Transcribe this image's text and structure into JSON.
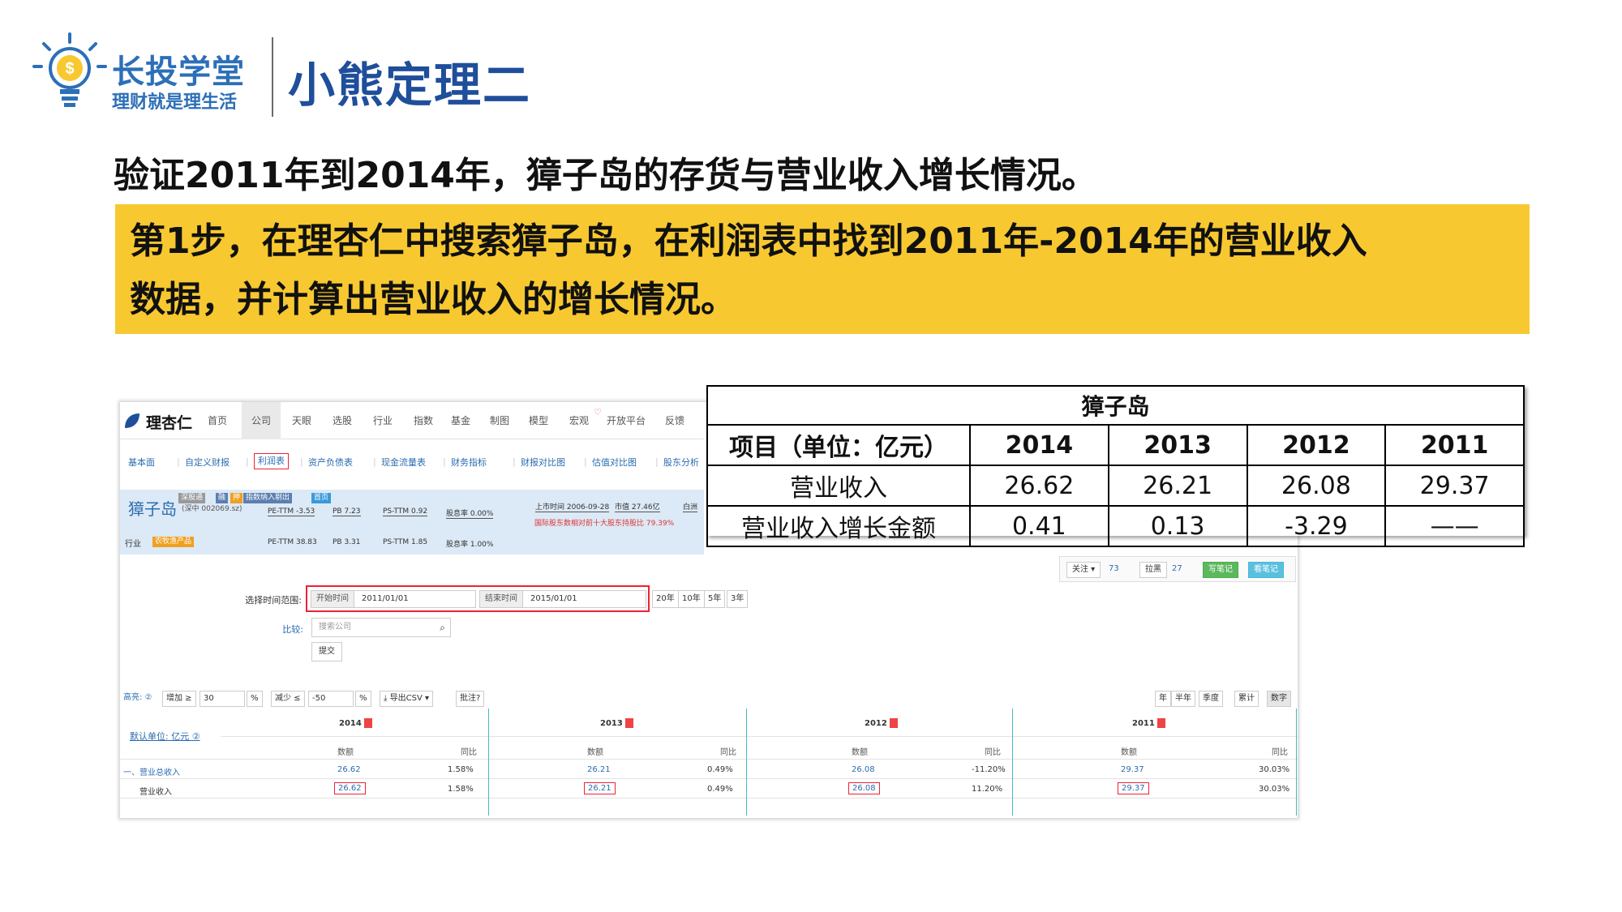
{
  "brand": {
    "name": "长投学堂",
    "slogan": "理财就是理生活",
    "colors": {
      "primary": "#2c6fb8",
      "bulb": "#f7c830"
    }
  },
  "slide": {
    "title": "小熊定理二",
    "intro": "验证2011年到2014年，獐子岛的存货与营业收入增长情况。",
    "step_line1": "第1步，在理杏仁中搜索獐子岛，在利润表中找到2011年-2014年的营业收入",
    "step_line2": "数据，并计算出营业收入的增长情况。",
    "step_bg": "#f7c830"
  },
  "site": {
    "logo": "理杏仁",
    "nav": [
      "首页",
      "公司",
      "天眼",
      "选股",
      "行业",
      "指数",
      "基金",
      "制图",
      "模型",
      "宏观",
      "开放平台",
      "反馈"
    ],
    "subnav": [
      "基本面",
      "自定义财报",
      "利润表",
      "资产负债表",
      "现金流量表",
      "财务指标",
      "财报对比图",
      "估值对比图",
      "股东分析"
    ],
    "stock": {
      "name": "獐子岛",
      "code": "(深中 002069.sz)",
      "tags": [
        "深股通",
        "融",
        "押",
        "指数纳入剔出",
        "首页"
      ],
      "row1": [
        "PE-TTM -3.53",
        "PB 7.23",
        "PS-TTM 0.92",
        "股息率 0.00%",
        "上市时间 2006-09-28",
        "市值 27.46亿",
        "白洲"
      ],
      "row2": [
        "PE-TTM 38.83",
        "PB 3.31",
        "PS-TTM 1.85",
        "股息率 1.00%"
      ],
      "holders": "国际股东数相对前十大股东持股比 79.39%",
      "industry_label": "行业",
      "industry": "农牧渔产品"
    },
    "toolbar": {
      "follow": "关注",
      "follow_count": "73",
      "dislike": "拉黑",
      "dislike_count": "27",
      "write": "写笔记",
      "view": "看笔记"
    },
    "form": {
      "period_label": "选择时间范围:",
      "start_label": "开始时间",
      "start_value": "2011/01/01",
      "end_label": "结束时间",
      "end_value": "2015/01/01",
      "ranges": [
        "20年",
        "10年",
        "5年",
        "3年"
      ],
      "compare_label": "比较:",
      "search_placeholder": "搜索公司",
      "submit": "提交"
    },
    "filters": {
      "highlight": "高亮: ②",
      "increase": "增加 ≥",
      "increase_val": "30",
      "pct": "%",
      "decrease": "减少 ≤",
      "decrease_val": "-50",
      "pct2": "%",
      "export": "导出CSV",
      "annotation": "批注?",
      "periods": [
        "年",
        "半年",
        "季度"
      ],
      "modes": [
        "累计",
        "数字"
      ]
    },
    "table": {
      "unit": "默认单位: 亿元 ②",
      "years": [
        "2014",
        "2013",
        "2012",
        "2011"
      ],
      "col_value": "数额",
      "col_yoy": "同比",
      "rows": [
        {
          "label": "一、营业总收入",
          "values": [
            "26.62",
            "1.58%",
            "26.21",
            "0.49%",
            "26.08",
            "-11.20%",
            "29.37",
            "30.03%"
          ]
        },
        {
          "label": "营业收入",
          "values": [
            "26.62",
            "1.58%",
            "26.21",
            "0.49%",
            "26.08",
            "11.20%",
            "29.37",
            "30.03%"
          ]
        }
      ]
    }
  },
  "summary": {
    "caption": "獐子岛",
    "header": [
      "项目（单位：亿元）",
      "2014",
      "2013",
      "2012",
      "2011"
    ],
    "rows": [
      [
        "营业收入",
        "26.62",
        "26.21",
        "26.08",
        "29.37"
      ],
      [
        "营业收入增长金额",
        "0.41",
        "0.13",
        "-3.29",
        "——"
      ]
    ]
  }
}
